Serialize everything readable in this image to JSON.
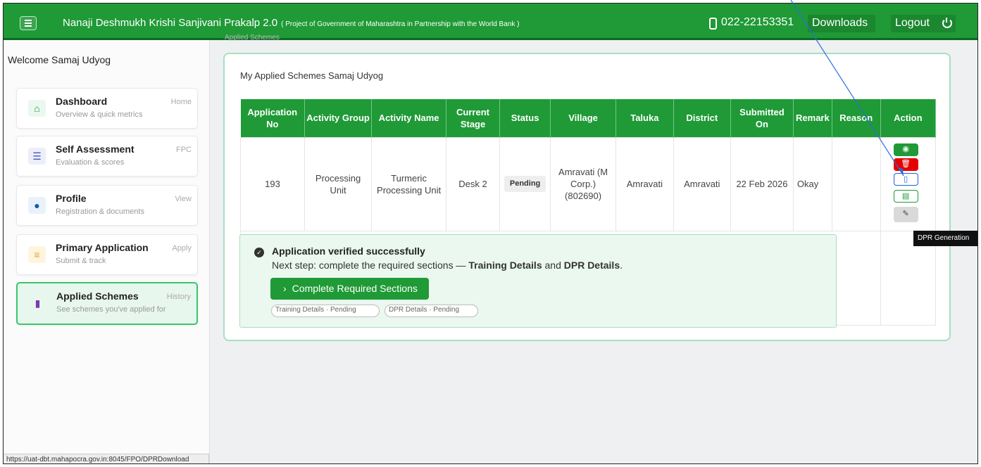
{
  "header": {
    "title": "Nanaji Deshmukh Krishi Sanjivani Prakalp 2.0",
    "subtitle": "( Project of Government of Maharashtra in Partnership with the World Bank )",
    "phone": "022-22153351",
    "downloads": "Downloads",
    "logout": "Logout"
  },
  "sidebar": {
    "welcome": "Welcome Samaj Udyog",
    "items": [
      {
        "title": "Dashboard",
        "desc": "Overview & quick metrics",
        "tag": "Home"
      },
      {
        "title": "Self Assessment",
        "desc": "Evaluation & scores",
        "tag": "FPC"
      },
      {
        "title": "Profile",
        "desc": "Registration & documents",
        "tag": "View"
      },
      {
        "title": "Primary Application",
        "desc": "Submit & track",
        "tag": "Apply"
      },
      {
        "title": "Applied Schemes",
        "desc": "See schemes you've applied for",
        "tag": "History"
      }
    ],
    "status_url": "https://uat-dbt.mahapocra.gov.in:8045/FPO/DPRDownload"
  },
  "breadcrumb": "Applied Schemes",
  "panel": {
    "title": "My Applied Schemes Samaj Udyog"
  },
  "table": {
    "headers": [
      "Application No",
      "Activity Group",
      "Activity Name",
      "Current Stage",
      "Status",
      "Village",
      "Taluka",
      "District",
      "Submitted On",
      "Remark",
      "Reason",
      "Action"
    ],
    "row": {
      "app_no": "193",
      "activity_group": "Processing Unit",
      "activity_name": "Turmeric Processing Unit",
      "current_stage": "Desk 2",
      "status": "Pending",
      "village": "Amravati (M Corp.) (802690)",
      "taluka": "Amravati",
      "district": "Amravati",
      "submitted_on": "22 Feb 2026",
      "remark": "Okay",
      "reason": ""
    }
  },
  "notice": {
    "title": "Application verified successfully",
    "text_prefix": "Next step: complete the required sections — ",
    "section1": "Training Details",
    "and_text": " and ",
    "section2": "DPR Details",
    "text_suffix": ".",
    "button": "Complete Required Sections",
    "pill1": "Training Details · Pending",
    "pill2": "DPR Details · Pending"
  },
  "tooltip": "DPR Generation"
}
